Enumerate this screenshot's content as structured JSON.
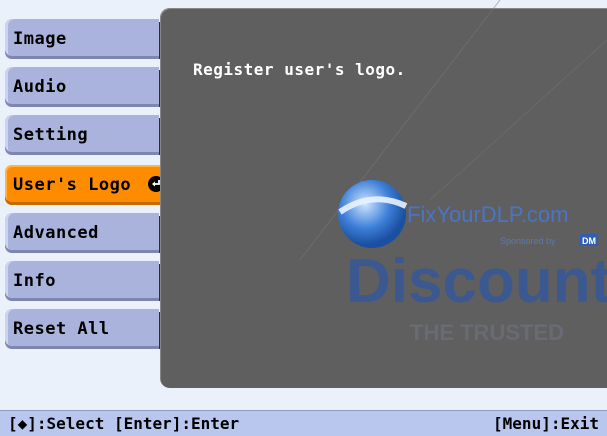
{
  "menu": {
    "items": [
      {
        "label": "Image"
      },
      {
        "label": "Audio"
      },
      {
        "label": "Setting"
      },
      {
        "label": "User's Logo",
        "active": true
      },
      {
        "label": "Advanced"
      },
      {
        "label": "Info"
      },
      {
        "label": "Reset All"
      }
    ]
  },
  "content": {
    "description": "Register user's logo."
  },
  "watermark": {
    "brand": "FixYourDLP.com",
    "sponsor": "Sponsored by",
    "sponsor_mark": "DM",
    "big": "Discount",
    "tagline": "THE TRUSTED"
  },
  "statusbar": {
    "left": "[◆]:Select [Enter]:Enter",
    "right": "[Menu]:Exit"
  },
  "colors": {
    "active_item": "#ff8c00",
    "menu_item": "#a9b3dc",
    "content_bg": "#5f5f5f",
    "statusbar_bg": "#b9c6ee"
  }
}
